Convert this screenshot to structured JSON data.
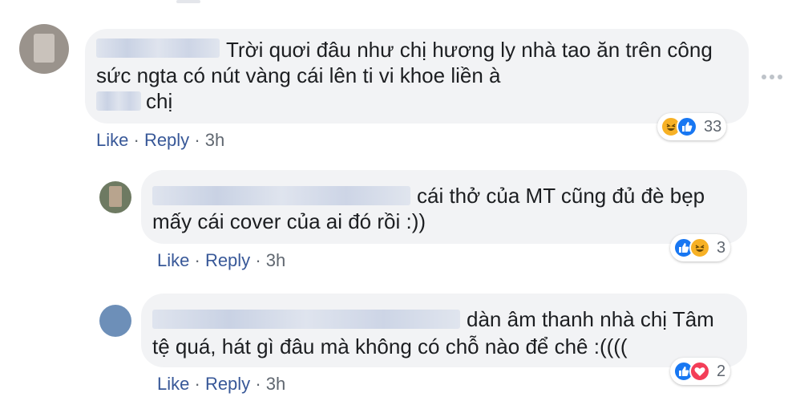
{
  "comments": [
    {
      "text_line1": "Trời quơi đâu như chị hương ly nhà tao ăn trên công",
      "text_line2": "sức ngta có nút vàng cái lên ti vi khoe liền à",
      "text_line3": "chị",
      "like_label": "Like",
      "reply_label": "Reply",
      "separator": "·",
      "time": "3h",
      "reaction_icons": [
        "haha-icon",
        "like-icon"
      ],
      "reaction_count": "33"
    },
    {
      "text_line1": "cái thở của MT cũng đủ đè bẹp",
      "text_line2": "mấy cái cover của ai đó rồi :))",
      "like_label": "Like",
      "reply_label": "Reply",
      "separator": "·",
      "time": "3h",
      "reaction_icons": [
        "like-icon",
        "haha-icon"
      ],
      "reaction_count": "3"
    },
    {
      "text_line1": "dàn âm thanh nhà chị Tâm",
      "text_line2": "tệ quá, hát gì đâu mà không có chỗ nào để chê :((((",
      "like_label": "Like",
      "reply_label": "Reply",
      "separator": "·",
      "time": "3h",
      "reaction_icons": [
        "like-icon",
        "love-icon"
      ],
      "reaction_count": "2"
    }
  ],
  "colors": {
    "link": "#385898",
    "bubble": "#f2f3f5",
    "meta_gray": "#606770",
    "like_blue": "#1877f2",
    "haha_yellow": "#f7b125",
    "love_red": "#f33e58"
  }
}
